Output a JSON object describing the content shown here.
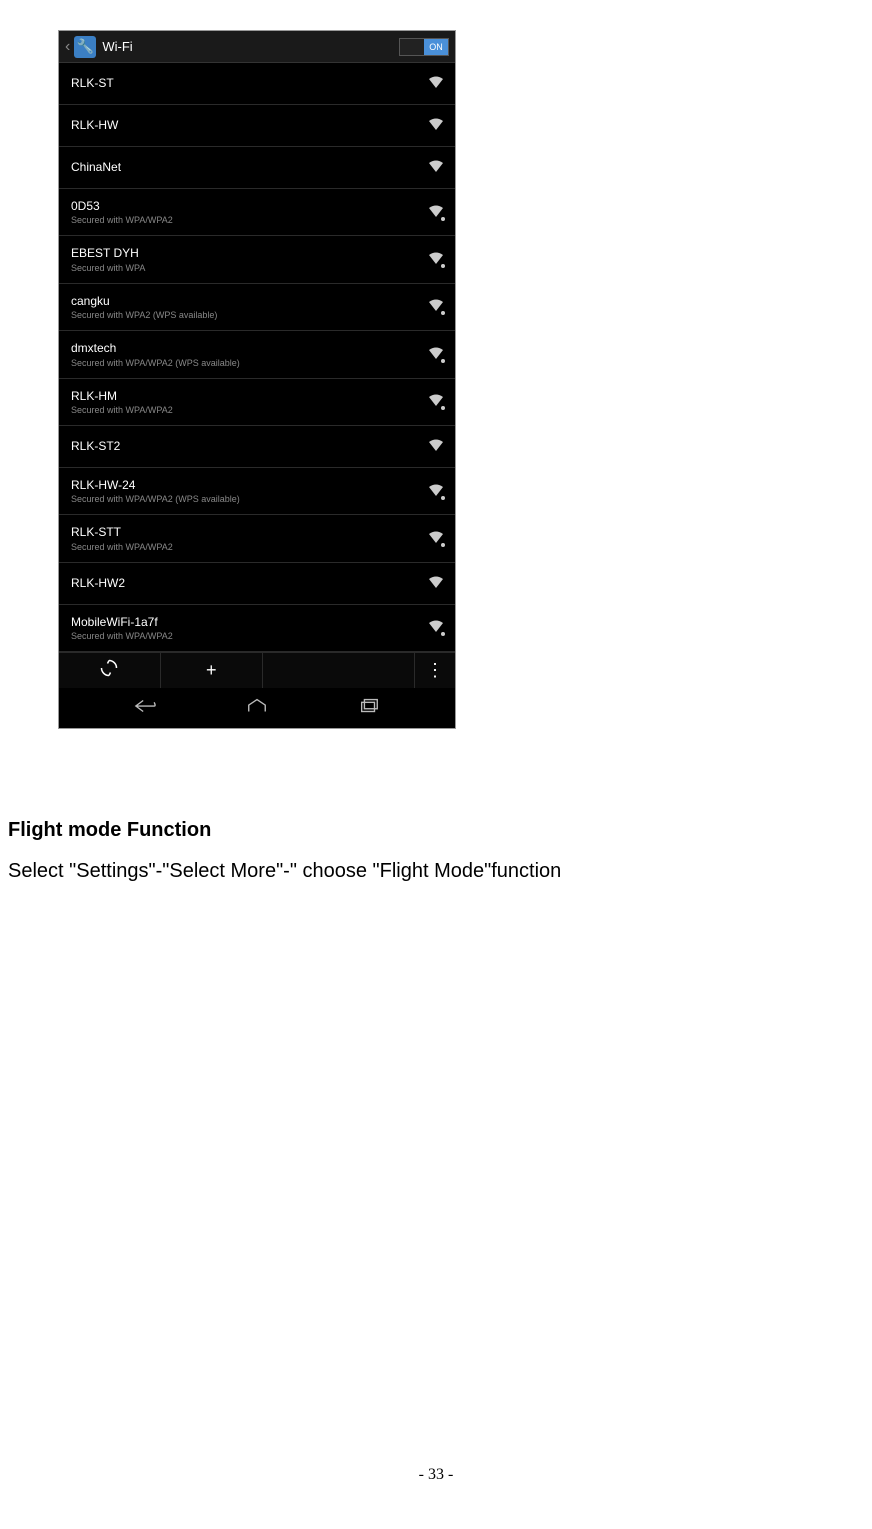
{
  "phone": {
    "header": {
      "title": "Wi-Fi",
      "toggle_label": "ON"
    },
    "networks": [
      {
        "name": "RLK-ST",
        "security": "",
        "locked": false
      },
      {
        "name": "RLK-HW",
        "security": "",
        "locked": false
      },
      {
        "name": "ChinaNet",
        "security": "",
        "locked": false
      },
      {
        "name": "0D53",
        "security": "Secured with WPA/WPA2",
        "locked": true
      },
      {
        "name": "EBEST DYH",
        "security": "Secured with WPA",
        "locked": true
      },
      {
        "name": "cangku",
        "security": "Secured with WPA2 (WPS available)",
        "locked": true
      },
      {
        "name": "dmxtech",
        "security": "Secured with WPA/WPA2 (WPS available)",
        "locked": true
      },
      {
        "name": "RLK-HM",
        "security": "Secured with WPA/WPA2",
        "locked": true
      },
      {
        "name": "RLK-ST2",
        "security": "",
        "locked": false
      },
      {
        "name": "RLK-HW-24",
        "security": "Secured with WPA/WPA2 (WPS available)",
        "locked": true
      },
      {
        "name": "RLK-STT",
        "security": "Secured with WPA/WPA2",
        "locked": true
      },
      {
        "name": "RLK-HW2",
        "security": "",
        "locked": false
      },
      {
        "name": "MobileWiFi-1a7f",
        "security": "Secured with WPA/WPA2",
        "locked": true
      }
    ]
  },
  "doc": {
    "heading": "Flight mode Function",
    "body": "Select \"Settings\"-\"Select More\"-\" choose \"Flight Mode\"function",
    "page_number": "- 33 -"
  }
}
